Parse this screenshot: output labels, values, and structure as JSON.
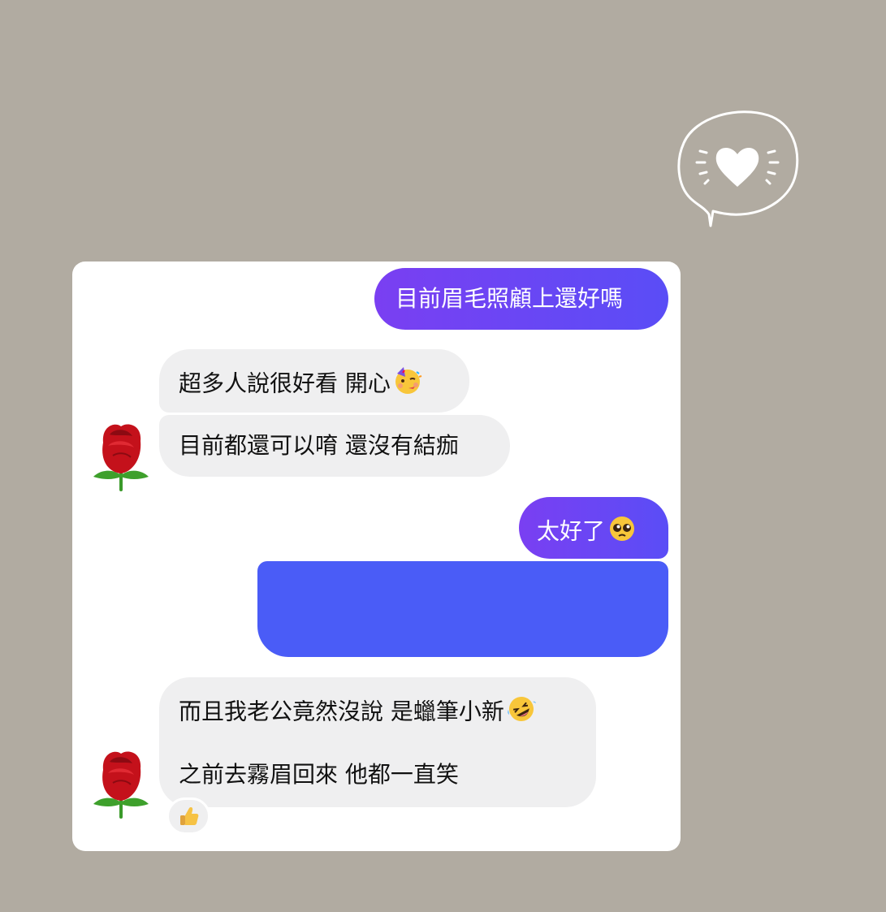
{
  "messages": {
    "m1": {
      "text": "目前眉毛照顧上還好嗎"
    },
    "m2": {
      "text": "超多人說很好看 開心",
      "emoji": "partying-face-icon"
    },
    "m3": {
      "text": "目前都還可以唷 還沒有結痂"
    },
    "m4": {
      "text": "太好了",
      "emoji": "pleading-face-icon"
    },
    "m5": {
      "text": ""
    },
    "m6": {
      "line1": "而且我老公竟然沒說 是蠟筆小新",
      "line1_emoji": "rolling-on-floor-laughing-icon",
      "line2": "之前去霧眉回來 他都一直笑",
      "reaction": "thumbs-up-icon"
    }
  },
  "avatars": {
    "contact": "rose-icon"
  },
  "sticker": "speech-bubble-heart-icon",
  "colors": {
    "background": "#b1aba1",
    "outgoing_gradient_start": "#7a3ff2",
    "outgoing_gradient_end": "#5a4df6",
    "outgoing_solid": "#4a5cf7",
    "incoming": "#efeff0"
  }
}
